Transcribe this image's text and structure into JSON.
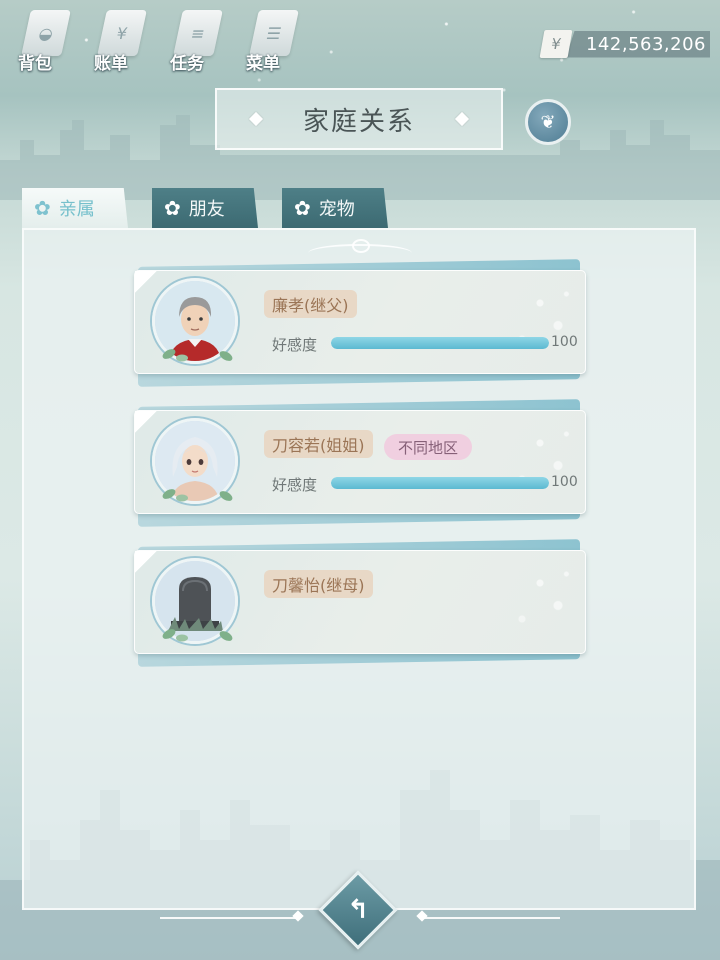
{
  "toolbar": [
    {
      "label": "背包",
      "icon": "backpack-icon",
      "glyph": "◒"
    },
    {
      "label": "账单",
      "icon": "bill-icon",
      "glyph": "¥"
    },
    {
      "label": "任务",
      "icon": "task-icon",
      "glyph": "≡"
    },
    {
      "label": "菜单",
      "icon": "menu-icon",
      "glyph": "☰"
    }
  ],
  "currency": {
    "symbol": "¥",
    "amount": "142,563,206"
  },
  "title": "家庭关系",
  "tabs": [
    {
      "label": "亲属",
      "active": true
    },
    {
      "label": "朋友",
      "active": false
    },
    {
      "label": "宠物",
      "active": false
    }
  ],
  "relatives": [
    {
      "name": "廉孝(继父)",
      "avatar": "elderly-man",
      "affection_label": "好感度",
      "affection_value": "100",
      "affection_fraction": 1.0,
      "region": null,
      "alive": true
    },
    {
      "name": "刀容若(姐姐)",
      "avatar": "silver-hair-girl",
      "affection_label": "好感度",
      "affection_value": "100",
      "affection_fraction": 1.0,
      "region": "不同地区",
      "alive": true
    },
    {
      "name": "刀馨怡(继母)",
      "avatar": "tombstone",
      "affection_label": null,
      "affection_value": null,
      "affection_fraction": null,
      "region": null,
      "alive": false
    }
  ],
  "colors": {
    "accent": "#76c0cc",
    "bar": "#5cb9d1",
    "name_tag": "#e8d8c6",
    "region_tag": "#f0cfe0"
  },
  "back_icon": "back-arrow-icon"
}
